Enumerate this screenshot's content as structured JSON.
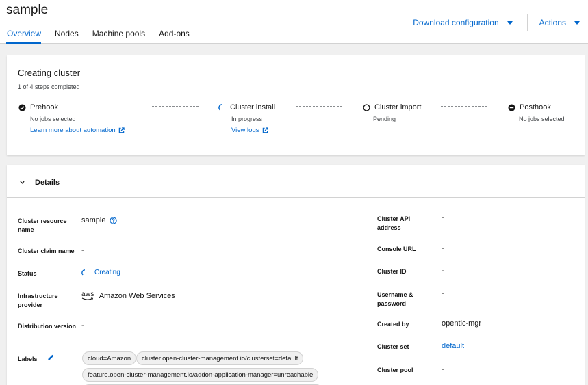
{
  "page": {
    "title": "sample"
  },
  "tabs": [
    {
      "label": "Overview",
      "active": true
    },
    {
      "label": "Nodes"
    },
    {
      "label": "Machine pools"
    },
    {
      "label": "Add-ons"
    }
  ],
  "header_actions": {
    "download": "Download configuration",
    "actions": "Actions"
  },
  "progress": {
    "title": "Creating cluster",
    "subtitle": "1 of 4 steps completed",
    "steps": [
      {
        "name": "Prehook",
        "status": "No jobs selected",
        "link": "Learn more about automation",
        "icon": "check-circle-icon"
      },
      {
        "name": "Cluster install",
        "status": "In progress",
        "link": "View logs",
        "icon": "spinner-icon"
      },
      {
        "name": "Cluster import",
        "status": "Pending",
        "icon": "circle-outline-icon"
      },
      {
        "name": "Posthook",
        "status": "No jobs selected",
        "icon": "minus-circle-icon"
      }
    ]
  },
  "details": {
    "title": "Details",
    "left": {
      "resource_name_label": "Cluster resource name",
      "resource_name_value": "sample",
      "claim_label": "Cluster claim name",
      "claim_value": "-",
      "status_label": "Status",
      "status_value": "Creating",
      "infra_label": "Infrastructure provider",
      "infra_value": "Amazon Web Services",
      "infra_logo": "aws",
      "dist_label": "Distribution version",
      "dist_value": "-",
      "labels_label": "Labels",
      "labels": [
        "cloud=Amazon",
        "cluster.open-cluster-management.io/clusterset=default",
        "feature.open-cluster-management.io/addon-application-manager=unreachable"
      ]
    },
    "right": {
      "api_label": "Cluster API address",
      "api_value": "-",
      "console_label": "Console URL",
      "console_value": "-",
      "id_label": "Cluster ID",
      "id_value": "-",
      "cred_label": "Username & password",
      "cred_value": "-",
      "created_label": "Created by",
      "created_value": "opentlc-mgr",
      "set_label": "Cluster set",
      "set_value": "default",
      "pool_label": "Cluster pool",
      "pool_value": "-"
    }
  },
  "colors": {
    "accent": "#0066cc",
    "text": "#151515",
    "muted": "#3c3f42",
    "page_bg": "#f0f0f0"
  }
}
